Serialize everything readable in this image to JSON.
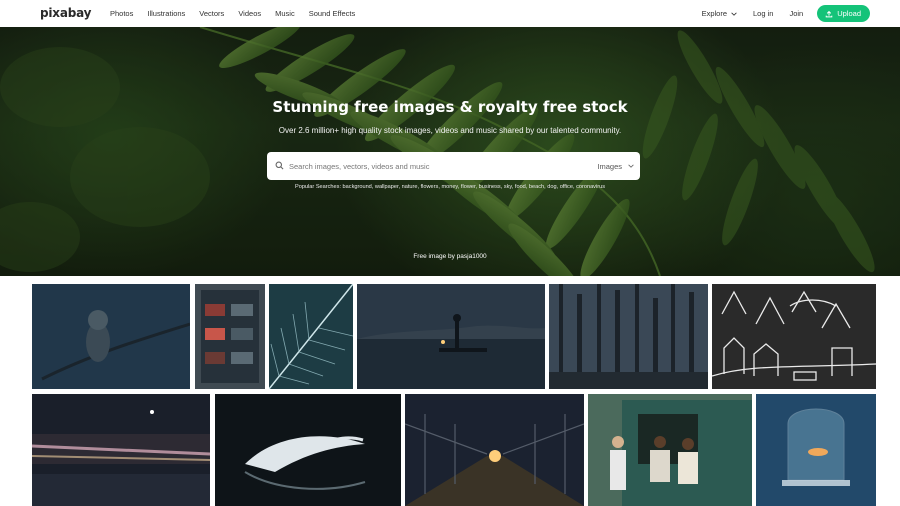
{
  "nav": {
    "logo": "pixabay",
    "links": [
      "Photos",
      "Illustrations",
      "Vectors",
      "Videos",
      "Music",
      "Sound Effects"
    ],
    "explore": "Explore",
    "login": "Log in",
    "join": "Join",
    "upload": "Upload"
  },
  "hero": {
    "title": "Stunning free images & royalty free stock",
    "subtitle": "Over 2.6 million+ high quality stock images, videos and music shared by our talented community.",
    "search": {
      "placeholder": "Search images, vectors, videos and music",
      "type": "Images"
    },
    "popular": "Popular Searches: background, wallpaper, nature, flowers, money, flower, business, sky, food, beach, dog, office, coronavirus",
    "credit": "Free image by pasja1000"
  },
  "colors": {
    "accent": "#14c379",
    "nav_text": "#333333"
  },
  "icons": {
    "search": "search-icon",
    "explore": "chevron-down-icon",
    "upload": "upload-icon",
    "type": "chevron-down-icon"
  }
}
